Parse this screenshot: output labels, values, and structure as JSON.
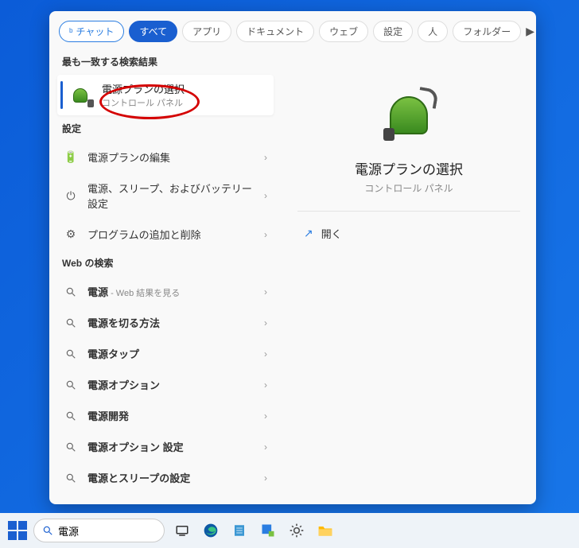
{
  "tabs": {
    "chat": "チャット",
    "all": "すべて",
    "apps": "アプリ",
    "docs": "ドキュメント",
    "web": "ウェブ",
    "settings": "設定",
    "people": "人",
    "folders": "フォルダー"
  },
  "sections": {
    "best_match": "最も一致する検索結果",
    "settings": "設定",
    "web_search": "Web の検索"
  },
  "best_match": {
    "title": "電源プランの選択",
    "subtitle": "コントロール パネル"
  },
  "settings_items": [
    {
      "icon": "battery",
      "label": "電源プランの編集"
    },
    {
      "icon": "power",
      "label": "電源、スリープ、およびバッテリー設定"
    },
    {
      "icon": "gear",
      "label": "プログラムの追加と削除"
    }
  ],
  "web_items": [
    {
      "term": "電源",
      "suffix": " - Web 結果を見る"
    },
    {
      "term": "電源を切る方法",
      "suffix": ""
    },
    {
      "term": "電源タップ",
      "suffix": ""
    },
    {
      "term": "電源オプション",
      "suffix": ""
    },
    {
      "term": "電源開発",
      "suffix": ""
    },
    {
      "term": "電源オプション 設定",
      "suffix": ""
    },
    {
      "term": "電源とスリープの設定",
      "suffix": ""
    }
  ],
  "preview": {
    "title": "電源プランの選択",
    "subtitle": "コントロール パネル",
    "open": "開く"
  },
  "search_value": "電源"
}
